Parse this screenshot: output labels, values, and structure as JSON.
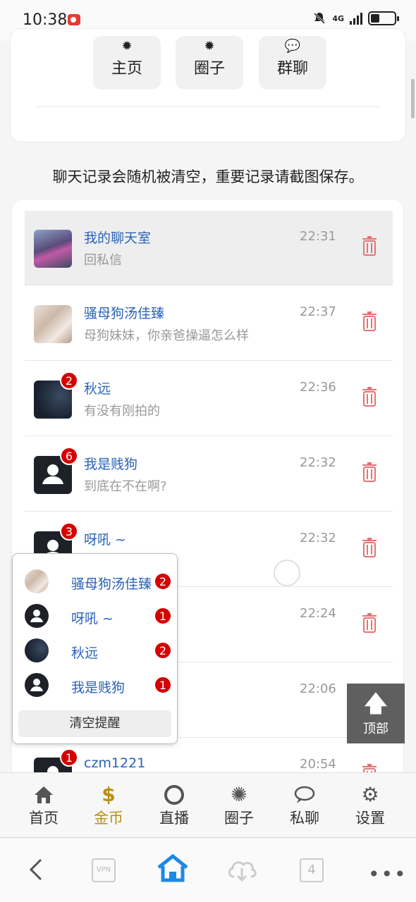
{
  "status_bar": {
    "time": "10:38",
    "network": "4G"
  },
  "top_card": {
    "buttons": [
      {
        "label": "主页",
        "icon": "gear-icon"
      },
      {
        "label": "圈子",
        "icon": "gear-icon"
      },
      {
        "label": "群聊",
        "icon": "chat-icon"
      }
    ]
  },
  "notice": "聊天记录会随机被清空，重要记录请截图保存。",
  "chats": [
    {
      "name": "我的聊天室",
      "message": "回私信",
      "time": "22:31"
    },
    {
      "name": "骚母狗汤佳臻",
      "message": "母狗妹妹，你亲爸操逼怎么样",
      "time": "22:37"
    },
    {
      "name": "秋远",
      "message": "有没有刚拍的",
      "time": "22:36",
      "badge": "2"
    },
    {
      "name": "我是贱狗",
      "message": "到底在不在啊?",
      "time": "22:32",
      "badge": "6"
    },
    {
      "name": "呀吼 ~",
      "message": "",
      "time": "22:32",
      "badge": "3"
    },
    {
      "name": "",
      "message": "",
      "time": "22:24"
    },
    {
      "name": "",
      "message": "",
      "time": "22:06"
    },
    {
      "name": "czm1221",
      "message": "",
      "time": "20:54",
      "badge": "1"
    }
  ],
  "popup": {
    "items": [
      {
        "name": "骚母狗汤佳臻",
        "badge": "2"
      },
      {
        "name": "呀吼 ~",
        "badge": "1"
      },
      {
        "name": "秋远",
        "badge": "2"
      },
      {
        "name": "我是贱狗",
        "badge": "1"
      }
    ],
    "clear_label": "清空提醒"
  },
  "top_button": {
    "label": "顶部"
  },
  "tab_bar": [
    {
      "label": "首页",
      "icon": "home-icon"
    },
    {
      "label": "金币",
      "icon": "dollar-icon",
      "active": true
    },
    {
      "label": "直播",
      "icon": "circle-icon"
    },
    {
      "label": "圈子",
      "icon": "sun-icon"
    },
    {
      "label": "私聊",
      "icon": "chat-icon"
    },
    {
      "label": "设置",
      "icon": "gear-icon"
    }
  ],
  "system_nav": {
    "vpn_label": "VPN",
    "tab_count": "4"
  },
  "colors": {
    "accent_gold": "#b8900e",
    "link_blue": "#2a62b8",
    "badge_red": "#d50000",
    "trash_red": "#e57373"
  }
}
